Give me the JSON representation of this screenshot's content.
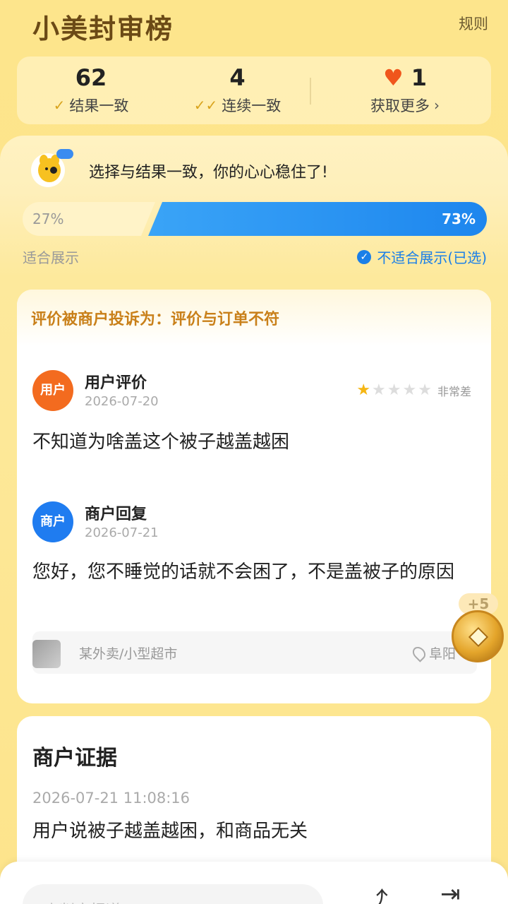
{
  "header": {
    "brand": "小美封审榜",
    "rules_label": "规则"
  },
  "stats": {
    "consistent_count": "62",
    "consistent_label": "结果一致",
    "streak_count": "4",
    "streak_label": "连续一致",
    "hearts_count": "1",
    "hearts_label": "获取更多",
    "icons": {
      "consistent": "check-icon",
      "streak": "double-check-icon",
      "hearts": "heart-icon"
    }
  },
  "result": {
    "banner": "选择与结果一致，你的心心稳住了!",
    "left_percent": "27%",
    "left_value": 0.27,
    "right_percent": "73%",
    "right_value": 0.73,
    "left_option": "适合展示",
    "right_option": "不适合展示(已选)"
  },
  "review": {
    "complaint": "评价被商户投诉为：评价与订单不符",
    "user_avatar": "用户",
    "user_title": "用户评价",
    "user_date": "2026-07-20",
    "rating_stars": 1,
    "rating_max": 5,
    "rating_label": "非常差",
    "user_text": "不知道为啥盖这个被子越盖越困",
    "merchant_avatar": "商户",
    "merchant_title": "商户回复",
    "merchant_date": "2026-07-21",
    "merchant_text": "您好，您不睡觉的话就不会困了，不是盖被子的原因",
    "shop_name": "某外卖/小型超市",
    "location": "阜阳"
  },
  "reward": {
    "plus": "+5"
  },
  "evidence": {
    "title": "商户证据",
    "time": "2026-07-21 11:08:16",
    "text": "用户说被子越盖越困，和商品无关"
  },
  "bottom": {
    "input_placeholder": "小判官报道"
  },
  "colors": {
    "accent_blue": "#1f86ee",
    "user_orange": "#f36b1f",
    "merchant_blue": "#1f7cf0",
    "complaint_text": "#c9801a"
  }
}
